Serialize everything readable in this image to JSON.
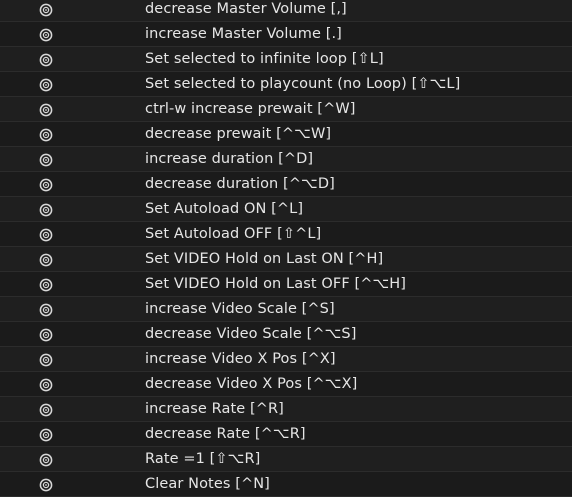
{
  "accent_color": "#e6e6e6",
  "row_icon": "target-radio-icon",
  "items": [
    {
      "label": "decrease Master Volume [,]"
    },
    {
      "label": "increase Master Volume [.]"
    },
    {
      "label": "Set selected to infinite loop [⇧L]"
    },
    {
      "label": "Set selected to playcount (no Loop) [⇧⌥L]"
    },
    {
      "label": "ctrl-w increase prewait [^W]"
    },
    {
      "label": "decrease prewait [^⌥W]"
    },
    {
      "label": "increase duration [^D]"
    },
    {
      "label": "decrease duration [^⌥D]"
    },
    {
      "label": "Set Autoload ON [^L]"
    },
    {
      "label": "Set Autoload OFF  [⇧^L]"
    },
    {
      "label": "Set VIDEO Hold on Last ON [^H]"
    },
    {
      "label": "Set VIDEO Hold on Last OFF  [^⌥H]"
    },
    {
      "label": "increase Video Scale [^S]"
    },
    {
      "label": "decrease Video Scale [^⌥S]"
    },
    {
      "label": "increase Video X Pos [^X]"
    },
    {
      "label": "decrease Video X Pos [^⌥X]"
    },
    {
      "label": "increase Rate [^R]"
    },
    {
      "label": "decrease Rate  [^⌥R]"
    },
    {
      "label": "Rate =1 [⇧⌥R]"
    },
    {
      "label": "Clear Notes [^N]"
    }
  ]
}
